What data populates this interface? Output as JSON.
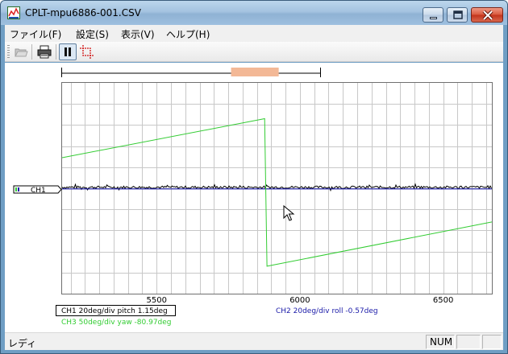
{
  "window": {
    "title": "CPLT-mpu6886-001.CSV",
    "icon": "app-chart-icon"
  },
  "menu": [
    {
      "label": "ファイル(F)"
    },
    {
      "label": "設定(S)"
    },
    {
      "label": "表示(V)"
    },
    {
      "label": "ヘルプ(H)"
    }
  ],
  "toolbar": {
    "buttons": [
      {
        "icon": "open-folder-icon",
        "enabled": false
      },
      {
        "icon": "print-icon",
        "enabled": true
      },
      {
        "icon": "pause-icon",
        "pressed": true
      },
      {
        "icon": "crop-icon",
        "enabled": true
      }
    ]
  },
  "scroll_overview": {
    "window_start_fraction": 0.656,
    "window_end_fraction": 0.84,
    "highlight_color": "#f3b896"
  },
  "channel_marker": {
    "label": "CH1"
  },
  "chart_data": {
    "type": "line",
    "grid": true,
    "x_ticks": [
      5500,
      6000,
      6500
    ],
    "xlim": [
      5170,
      6670
    ],
    "ylim": [
      -5,
      5
    ],
    "series": [
      {
        "name": "CH1 20deg/div pitch 1.15deg",
        "color": "#000000",
        "shape": "noisy-flat",
        "level": 0.05,
        "noise": 0.06
      },
      {
        "name": "CH2 20deg/div roll -0.57deg",
        "color": "#1a1aa8",
        "shape": "flat",
        "level": -0.03
      },
      {
        "name": "CH3 50deg/div yaw -80.97deg",
        "color": "#33cc33",
        "shape": "sawtooth",
        "points": [
          {
            "x": 5170,
            "y": 1.45
          },
          {
            "x": 5877,
            "y": 3.3
          },
          {
            "x": 5885,
            "y": -3.7
          },
          {
            "x": 6670,
            "y": -1.6
          }
        ]
      }
    ],
    "legend": [
      {
        "text": "CH1 20deg/div pitch 1.15deg",
        "color": "#000000",
        "boxed": true
      },
      {
        "text": "CH2 20deg/div roll -0.57deg",
        "color": "#1a1aa8",
        "boxed": false
      },
      {
        "text": "CH3 50deg/div yaw -80.97deg",
        "color": "#33cc33",
        "boxed": false
      }
    ]
  },
  "status": {
    "text": "レディ",
    "num": "NUM"
  }
}
